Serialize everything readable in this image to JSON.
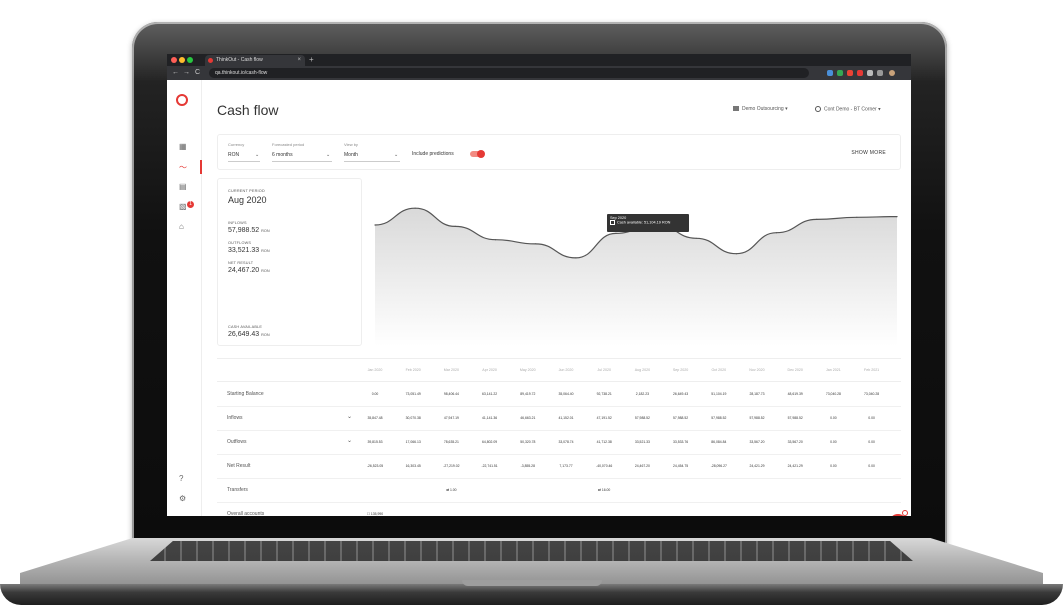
{
  "browser": {
    "tab_title": "ThinkOut - Cash flow",
    "tab_close": "×",
    "new_tab": "+",
    "url": "qa.thinkout.io/cash-flow",
    "nav_back": "←",
    "nav_forward": "→",
    "nav_reload": "C"
  },
  "header": {
    "title": "Cash flow",
    "organization": "Demo Outsourcing ▾",
    "user": "Cont Demo - BT Corner ▾"
  },
  "filters": {
    "currency_label": "Currency",
    "currency_value": "RON",
    "period_label": "Forecasted period",
    "period_value": "6 months",
    "viewby_label": "View by",
    "viewby_value": "Month",
    "predictions_label": "Include predictions",
    "predictions_on": true,
    "show_more": "SHOW MORE",
    "caret": "⌄"
  },
  "summary": {
    "period_label": "CURRENT PERIOD",
    "period_value": "Aug 2020",
    "inflows_label": "INFLOWS",
    "inflows_value": "57,988.52",
    "outflows_label": "OUTFLOWS",
    "outflows_value": "33,521.33",
    "net_label": "NET RESULT",
    "net_value": "24,467.20",
    "cash_label": "CASH AVAILABLE",
    "cash_value": "26,649.43",
    "unit": "RON"
  },
  "tooltip": {
    "title": "Sep 2020",
    "text": "Cash available: 51,104.19 RON"
  },
  "chart_data": {
    "type": "area",
    "x": [
      "Jan 2020",
      "Feb 2020",
      "Mar 2020",
      "Apr 2020",
      "May 2020",
      "Jun 2020",
      "Jul 2020",
      "Aug 2020",
      "Sep 2020",
      "Oct 2020",
      "Nov 2020",
      "Dec 2020",
      "Jan 2021",
      "Feb 2021"
    ],
    "y": [
      50,
      74,
      48,
      29,
      23,
      3,
      38,
      51,
      31,
      9,
      39,
      58,
      61,
      62
    ],
    "ylim": [
      0,
      100
    ],
    "grid": false,
    "title": "",
    "xlabel": "",
    "ylabel": ""
  },
  "table": {
    "months": [
      "Jan 2020",
      "Feb 2020",
      "Mar 2020",
      "Apr 2020",
      "May 2020",
      "Jun 2020",
      "Jul 2020",
      "Aug 2020",
      "Sep 2020",
      "Oct 2020",
      "Nov 2020",
      "Dec 2020",
      "Jan 2021",
      "Feb 2021"
    ],
    "rows": [
      {
        "label": "Starting Balance",
        "expandable": false,
        "values": [
          "0.00",
          "73,051.49",
          "98,406.44",
          "63,141.22",
          "89,419.72",
          "35,064.40",
          "92,738.21",
          "2,182.23",
          "26,649.43",
          "51,104.19",
          "28,187.73",
          "48,619.39",
          "73,040.28",
          "73,040.28"
        ]
      },
      {
        "label": "Inflows",
        "expandable": true,
        "values": [
          "35,847.48",
          "30,070.38",
          "47,947.19",
          "41,141.36",
          "46,663.21",
          "41,152.01",
          "47,191.52",
          "57,988.52",
          "57,988.52",
          "57,988.52",
          "57,988.52",
          "57,988.52",
          "0.00",
          "0.00"
        ]
      },
      {
        "label": "Outflows",
        "expandable": true,
        "values": [
          "39,815.53",
          "17,066.13",
          "78,635.21",
          "64,802.09",
          "50,320.78",
          "33,078.74",
          "41,712.38",
          "33,521.33",
          "33,533.76",
          "86,084.84",
          "33,567.20",
          "33,567.20",
          "0.00",
          "0.00"
        ]
      },
      {
        "label": "Net Result",
        "expandable": false,
        "values": [
          "-26,523.05",
          "16,303.45",
          "-27,219.02",
          "-22,741.51",
          "-3,855.28",
          "7,173.77",
          "-40,070.46",
          "24,467.20",
          "24,454.75",
          "-28,096.27",
          "24,421.29",
          "24,421.29",
          "0.00",
          "0.00"
        ]
      },
      {
        "label": "Transfers",
        "expandable": false,
        "values": [
          "",
          "",
          "⇄ 1.00",
          "",
          "",
          "",
          "⇄ 16.00",
          "",
          "",
          "",
          "",
          "",
          "",
          ""
        ]
      },
      {
        "label": "Overall accounts",
        "expandable": false,
        "values": [
          "☐ 135,990",
          "",
          "",
          "",
          "",
          "",
          "",
          "",
          "",
          "",
          "",
          "",
          "",
          ""
        ]
      }
    ]
  },
  "sidebar": {
    "items": [
      {
        "name": "dashboard-icon",
        "glyph": "▦"
      },
      {
        "name": "cashflow-icon",
        "glyph": "〜"
      },
      {
        "name": "documents-icon",
        "glyph": "▤"
      },
      {
        "name": "invoices-icon",
        "glyph": "▧"
      },
      {
        "name": "bank-icon",
        "glyph": "⌂"
      }
    ],
    "notification_count": "1",
    "help_glyph": "?",
    "settings_glyph": "⚙"
  },
  "colors": {
    "accent": "#e53935",
    "text": "#333333",
    "muted": "#888888",
    "line": "#555555"
  }
}
